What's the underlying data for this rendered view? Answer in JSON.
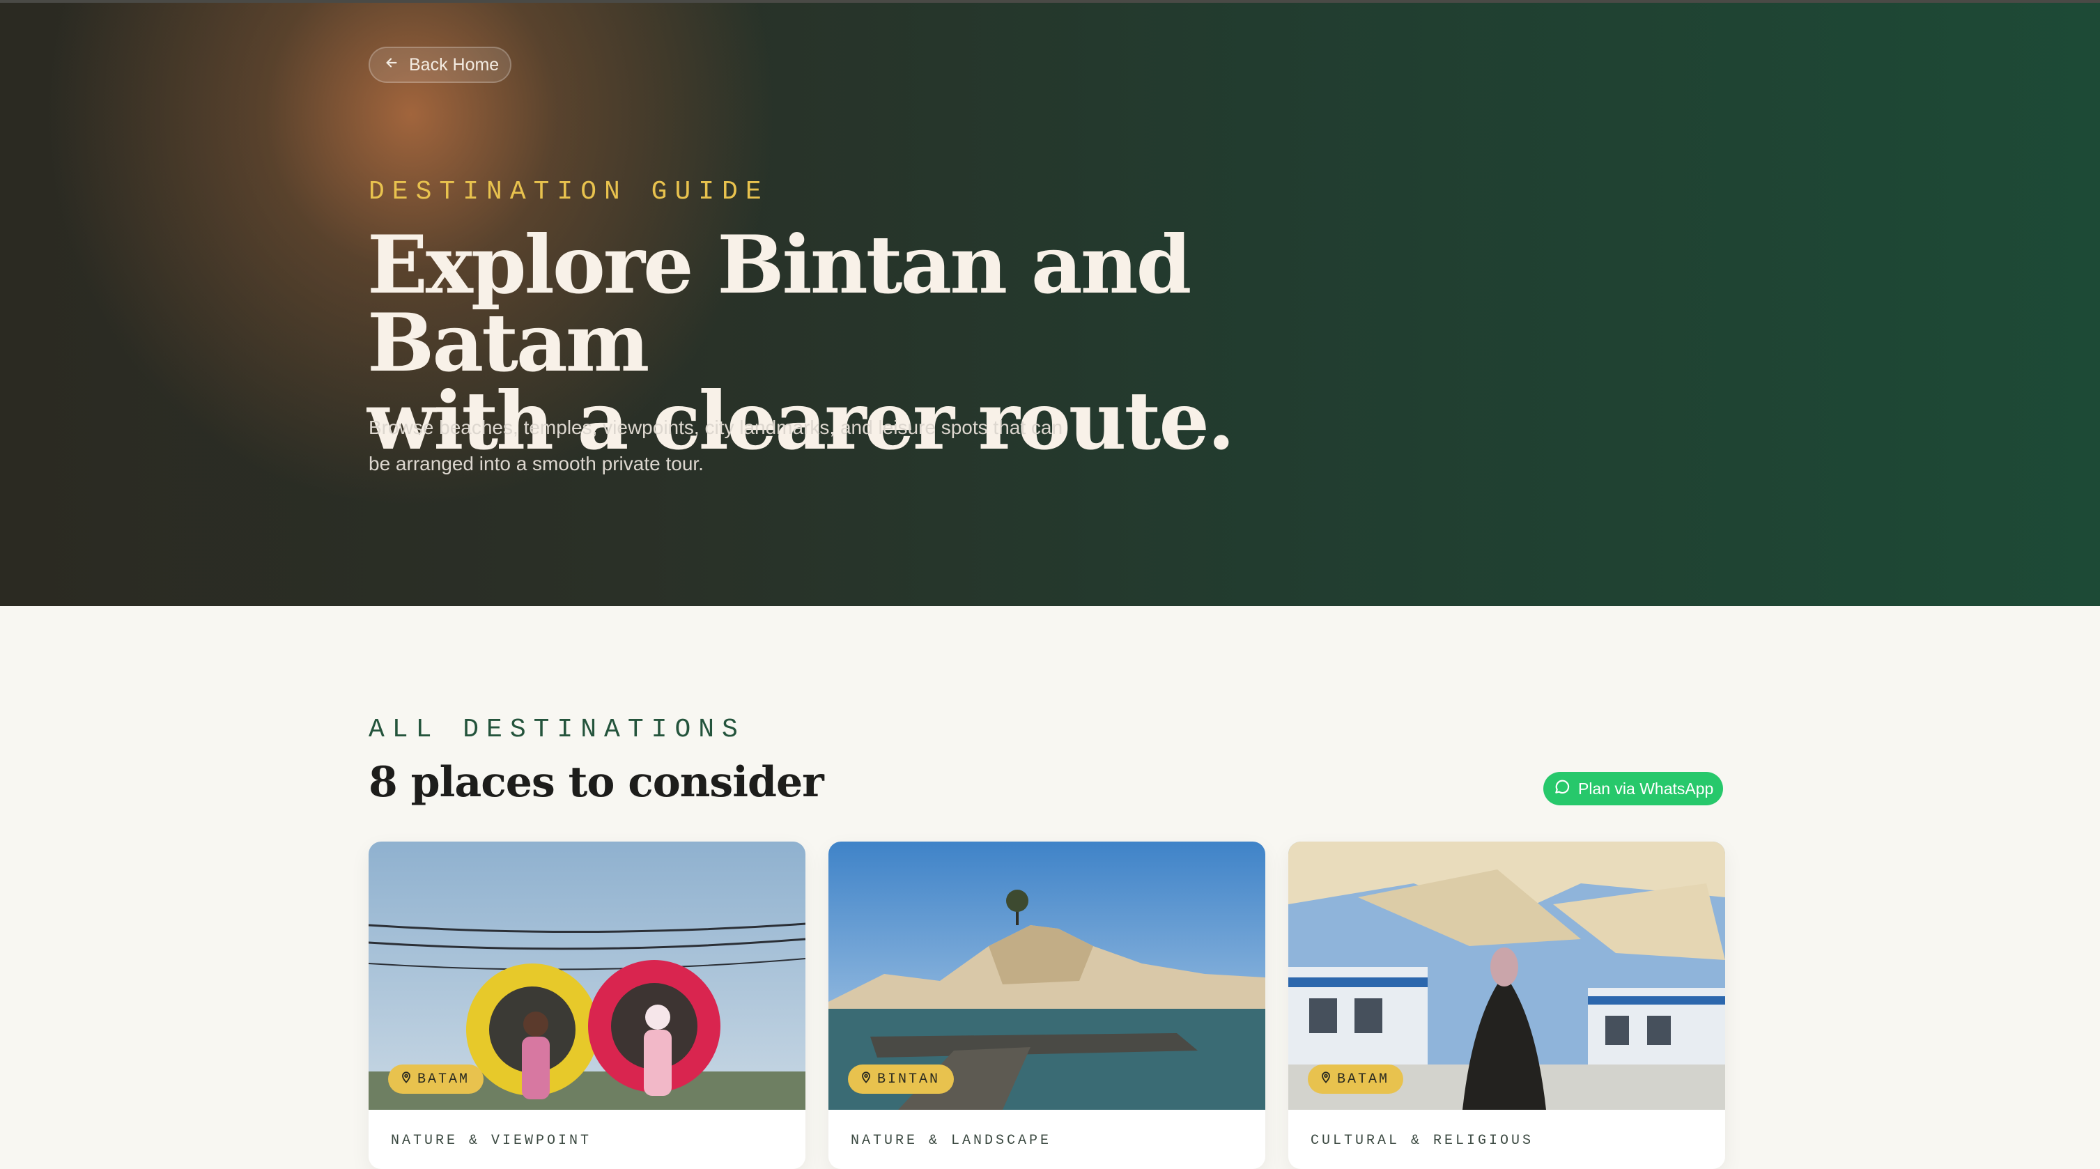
{
  "hero": {
    "back_label": "Back Home",
    "eyebrow": "DESTINATION GUIDE",
    "title_line1": "Explore Bintan and Batam",
    "title_line2": "with a clearer route.",
    "subtitle_line1": "Browse beaches, temples, viewpoints, city landmarks, and leisure spots that can",
    "subtitle_line2": "be arranged into a smooth private tour."
  },
  "destinations": {
    "eyebrow": "ALL DESTINATIONS",
    "title": "8 places to consider",
    "whatsapp_label": "Plan via WhatsApp",
    "cards": [
      {
        "location": "BATAM",
        "category": "NATURE & VIEWPOINT"
      },
      {
        "location": "BINTAN",
        "category": "NATURE & LANDSCAPE"
      },
      {
        "location": "BATAM",
        "category": "CULTURAL & RELIGIOUS"
      }
    ]
  },
  "colors": {
    "accent_gold": "#e8c24e",
    "brand_green": "#24543c",
    "whatsapp_green": "#27c86b"
  }
}
